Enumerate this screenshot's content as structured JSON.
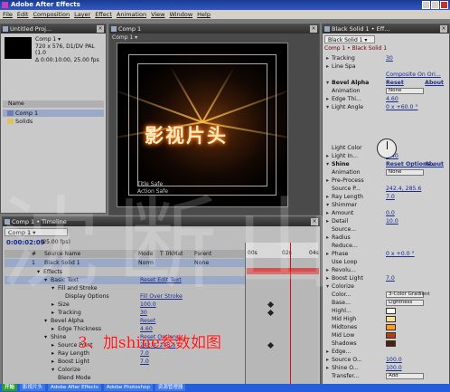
{
  "app": {
    "title": "Adobe After Effects"
  },
  "menu": [
    "File",
    "Edit",
    "Composition",
    "Layer",
    "Effect",
    "Animation",
    "View",
    "Window",
    "Help"
  ],
  "project": {
    "title": "Untitled Proj...",
    "comp_name": "Comp 1 ▾",
    "info": [
      "720 x 576, D1/DV PAL (1.0",
      "Δ 0:00:10:00, 25.00 fps"
    ],
    "col_name": "Name",
    "items": [
      "Comp 1",
      "Solids"
    ]
  },
  "comp": {
    "title": "Comp 1",
    "tab": "Comp 1 ▾",
    "canvas_title": "影视片头",
    "safe_labels": [
      "Title Safe",
      "Action Safe"
    ]
  },
  "effects": {
    "title": "Black Solid 1 • Eff...",
    "tab": "Black Solid 1 ▾",
    "breadcrumb": "Comp 1 • Black Solid 1",
    "rows": [
      {
        "label": "Tracking",
        "value": "30",
        "tw": "▸"
      },
      {
        "label": "Line Spa",
        "value": "",
        "tw": "▸"
      },
      {
        "label": "",
        "value": "Composite On Ori...",
        "tw": ""
      },
      {
        "label": "Bevel Alpha",
        "value": "Reset",
        "extra": "About",
        "tw": "▾",
        "hdr": true
      },
      {
        "label": "Animation",
        "value": "None",
        "tw": "",
        "dd": true
      },
      {
        "label": "Edge Thi...",
        "value": "4.60",
        "tw": "▸"
      },
      {
        "label": "Light Angle",
        "value": "0 x +60.0 °",
        "tw": "▾"
      },
      {
        "label": "",
        "value": "",
        "tw": ""
      },
      {
        "label": "",
        "value": "",
        "tw": ""
      },
      {
        "label": "",
        "value": "",
        "tw": ""
      },
      {
        "label": "",
        "value": "",
        "tw": ""
      },
      {
        "label": "Light Color",
        "value": "",
        "tw": "",
        "swatch": "#ffffff"
      },
      {
        "label": "Light In...",
        "value": "0.40",
        "tw": "▸"
      },
      {
        "label": "Shine",
        "value": "Reset Options...",
        "extra": "About",
        "tw": "▾",
        "hdr": true
      },
      {
        "label": "Animation",
        "value": "None",
        "tw": "",
        "dd": true
      },
      {
        "label": "Pre-Process",
        "value": "",
        "tw": "▸"
      },
      {
        "label": "Source P...",
        "value": "242.4, 285.6",
        "tw": ""
      },
      {
        "label": "Ray Length",
        "value": "7.0",
        "tw": "▸"
      },
      {
        "label": "Shimmer",
        "value": "",
        "tw": "▾"
      },
      {
        "label": "Amount",
        "value": "0.0",
        "tw": "▸"
      },
      {
        "label": "Detail",
        "value": "10.0",
        "tw": "▸"
      },
      {
        "label": "Source...",
        "value": "",
        "tw": ""
      },
      {
        "label": "Radius",
        "value": "",
        "tw": "▸"
      },
      {
        "label": "Reduce...",
        "value": "",
        "tw": ""
      },
      {
        "label": "Phase",
        "value": "0 x +0.0 °",
        "tw": "▸"
      },
      {
        "label": "Use Loop",
        "value": "",
        "tw": ""
      },
      {
        "label": "Revolu...",
        "value": "",
        "tw": "▸"
      },
      {
        "label": "Boost Light",
        "value": "7.0",
        "tw": "▸"
      },
      {
        "label": "Colorize",
        "value": "",
        "tw": "▾"
      },
      {
        "label": "Color...",
        "value": "3-Color Gradient",
        "tw": "",
        "dd": true
      },
      {
        "label": "Base...",
        "value": "Lightness",
        "tw": "",
        "dd": true
      },
      {
        "label": "Highl...",
        "value": "",
        "tw": "",
        "swatch": "#ffffff"
      },
      {
        "label": "Mid High",
        "value": "",
        "tw": "",
        "swatch": "#ffe08a"
      },
      {
        "label": "Midtones",
        "value": "",
        "tw": "",
        "swatch": "#ff9a20"
      },
      {
        "label": "Mid Low",
        "value": "",
        "tw": "",
        "swatch": "#b04010"
      },
      {
        "label": "Shadows",
        "value": "",
        "tw": "",
        "swatch": "#502010"
      },
      {
        "label": "Edge...",
        "value": "",
        "tw": "▸"
      },
      {
        "label": "Source O...",
        "value": "100.0",
        "tw": "▸"
      },
      {
        "label": "Shine O...",
        "value": "100.0",
        "tw": "▸"
      },
      {
        "label": "Transfer...",
        "value": "Add",
        "tw": "",
        "dd": true
      }
    ]
  },
  "timeline": {
    "title": "Comp 1 • Timeline",
    "tab": "Comp 1 ▾",
    "timecode": "0:00:02:09",
    "fps": "(25.00 fps)",
    "headers": [
      "#",
      "Source Name",
      "Mode",
      "T TrkMat",
      "Parent"
    ],
    "ruler_marks": [
      "00s",
      "02s",
      "04s"
    ],
    "layer": {
      "num": "1",
      "name": "Black Solid 1",
      "mode": "Norm",
      "parent": "None"
    },
    "rows": [
      {
        "name": "Effects",
        "value": "",
        "indent": 1,
        "tw": "▾"
      },
      {
        "name": "Basic Text",
        "value": "Reset  Edit Text",
        "indent": 2,
        "tw": "▾",
        "sel": true
      },
      {
        "name": "Fill and Stroke",
        "value": "",
        "indent": 3,
        "tw": "▾"
      },
      {
        "name": "Display Options",
        "value": "Fill Over Stroke",
        "indent": 4,
        "tw": ""
      },
      {
        "name": "Size",
        "value": "100.0",
        "indent": 3,
        "tw": "▸",
        "kf": true
      },
      {
        "name": "Tracking",
        "value": "30",
        "indent": 3,
        "tw": "▸",
        "kf": true
      },
      {
        "name": "Bevel Alpha",
        "value": "Reset",
        "indent": 2,
        "tw": "▾"
      },
      {
        "name": "Edge Thickness",
        "value": "4.60",
        "indent": 3,
        "tw": "▸"
      },
      {
        "name": "Shine",
        "value": "Reset  Options...",
        "indent": 2,
        "tw": "▾"
      },
      {
        "name": "Source Point",
        "value": "242.4, 285.6",
        "indent": 3,
        "tw": "▸",
        "kf": true
      },
      {
        "name": "Ray Length",
        "value": "7.0",
        "indent": 3,
        "tw": "▸"
      },
      {
        "name": "Boost Light",
        "value": "7.0",
        "indent": 3,
        "tw": "▸"
      },
      {
        "name": "Colorize",
        "value": "",
        "indent": 3,
        "tw": "▾"
      },
      {
        "name": "Blend Mode",
        "value": "",
        "indent": 3,
        "tw": ""
      }
    ]
  },
  "overlay": {
    "caption": "3、加shine参数如图",
    "watermark": "沈断山"
  },
  "taskbar": [
    "开始",
    "影视片头",
    "Adobe After Effects",
    "Adobe Photoshop",
    "资源管理器"
  ]
}
